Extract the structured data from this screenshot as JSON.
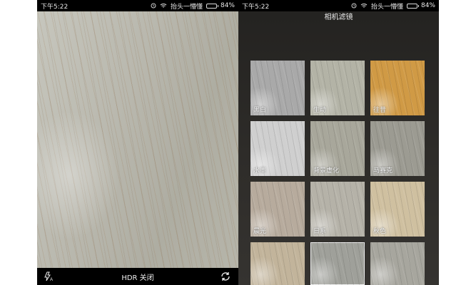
{
  "status_bar": {
    "time": "下午5:22",
    "carrier": "抬头一懵懂",
    "battery": "84%",
    "battery_level": 0.84
  },
  "camera": {
    "hdr_label": "HDR 关闭",
    "flash_icon": "flash-auto-icon",
    "switch_icon": "camera-switch-icon"
  },
  "filters": {
    "title": "相机滤镜",
    "items": [
      {
        "label": "黑白",
        "color": "#a9a9a9"
      },
      {
        "label": "生动",
        "color": "#b3b3a6"
      },
      {
        "label": "往昔",
        "color": "#d09a45"
      },
      {
        "label": "水墨",
        "color": "#cfcfcf"
      },
      {
        "label": "背景虚化",
        "color": "#a8a79b"
      },
      {
        "label": "马赛克",
        "color": "#9c9b92"
      },
      {
        "label": "晨光",
        "color": "#b7ab9d"
      },
      {
        "label": "日系",
        "color": "#b5b2a8"
      },
      {
        "label": "秋色",
        "color": "#cfc0a0"
      },
      {
        "label": "",
        "color": "#c2b49b"
      },
      {
        "label": "",
        "color": "#9fa09a"
      },
      {
        "label": "",
        "color": "#a7a69e"
      }
    ],
    "selected_index": 10
  }
}
